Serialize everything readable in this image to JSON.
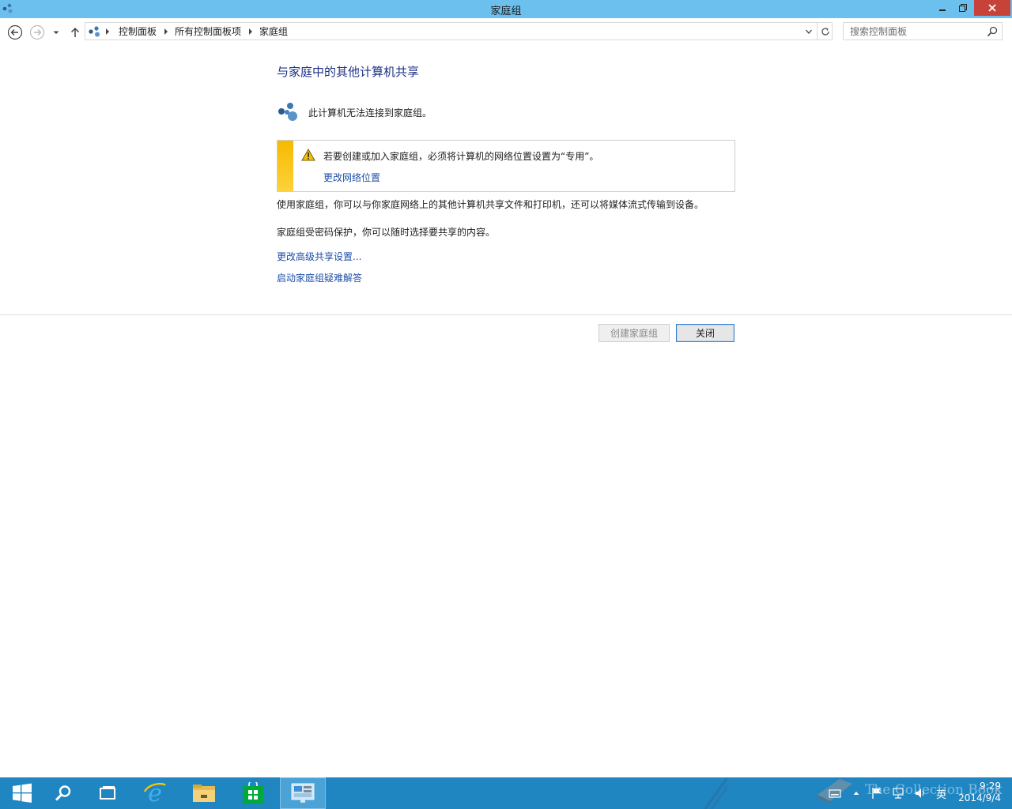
{
  "window": {
    "title": "家庭组"
  },
  "address_bar": {
    "breadcrumbs": [
      "控制面板",
      "所有控制面板项",
      "家庭组"
    ]
  },
  "search": {
    "placeholder": "搜索控制面板"
  },
  "content": {
    "heading": "与家庭中的其他计算机共享",
    "status_text": "此计算机无法连接到家庭组。",
    "warning_text": "若要创建或加入家庭组，必须将计算机的网络位置设置为“专用”。",
    "warning_link": "更改网络位置",
    "paragraph1": "使用家庭组，你可以与你家庭网络上的其他计算机共享文件和打印机，还可以将媒体流式传输到设备。",
    "paragraph2": "家庭组受密码保护，你可以随时选择要共享的内容。",
    "link_advanced_sharing": "更改高级共享设置...",
    "link_troubleshoot": "启动家庭组疑难解答"
  },
  "buttons": {
    "create_homegroup": "创建家庭组",
    "close": "关闭"
  },
  "taskbar": {
    "items": [
      "start-icon",
      "search-icon",
      "task-view-icon",
      "internet-explorer-icon",
      "file-explorer-icon",
      "store-icon",
      "control-panel-icon"
    ],
    "tray_language": "英",
    "clock_time": "9:29",
    "clock_date": "2014/9/4",
    "watermark": "The Collection Book"
  },
  "colors": {
    "titlebar": "#6cc0ee",
    "close_button": "#c7433a",
    "heading": "#1e3287",
    "link": "#1e4fa8",
    "warning_stripe": "#f7b900",
    "taskbar": "#1f86c2"
  }
}
